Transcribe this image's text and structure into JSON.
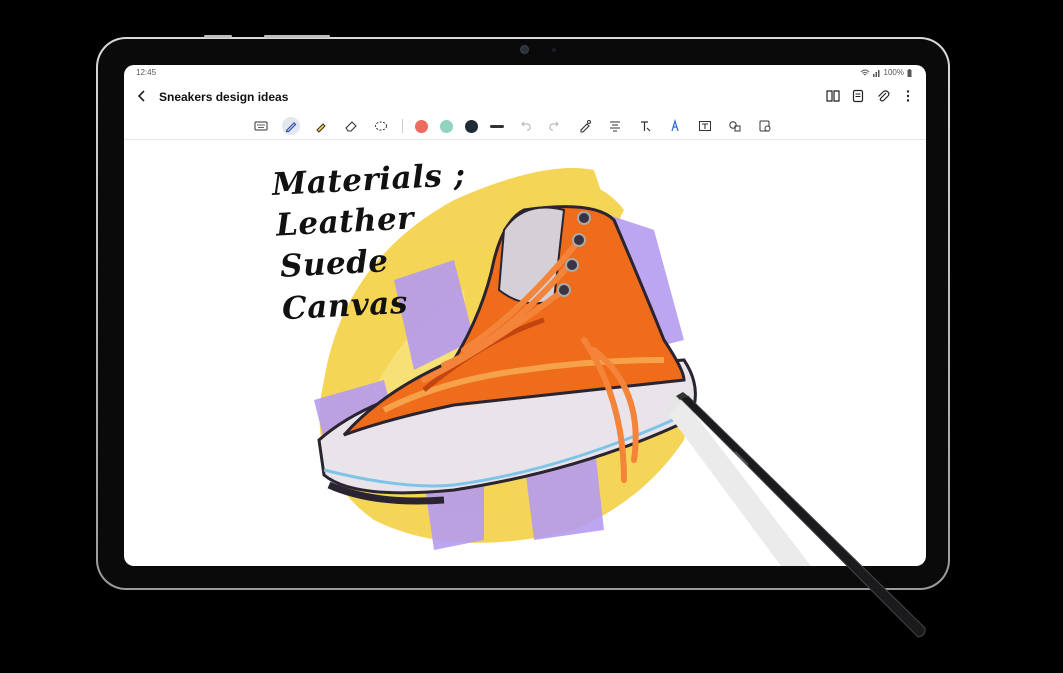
{
  "status_bar": {
    "time": "12:45",
    "battery": "100%"
  },
  "header": {
    "title": "Sneakers design ideas"
  },
  "toolbar": {
    "colors": [
      "#ec6b5e",
      "#8fd3c0",
      "#1f2c35"
    ],
    "line_color": "#333333"
  },
  "note": {
    "handwriting": [
      "Materials ;",
      "Leather",
      "Suede",
      "Canvas"
    ]
  },
  "icons": {
    "back": "chevron-left-icon",
    "book": "book-view-icon",
    "page": "page-icon",
    "attach": "paperclip-icon",
    "more": "more-icon"
  }
}
